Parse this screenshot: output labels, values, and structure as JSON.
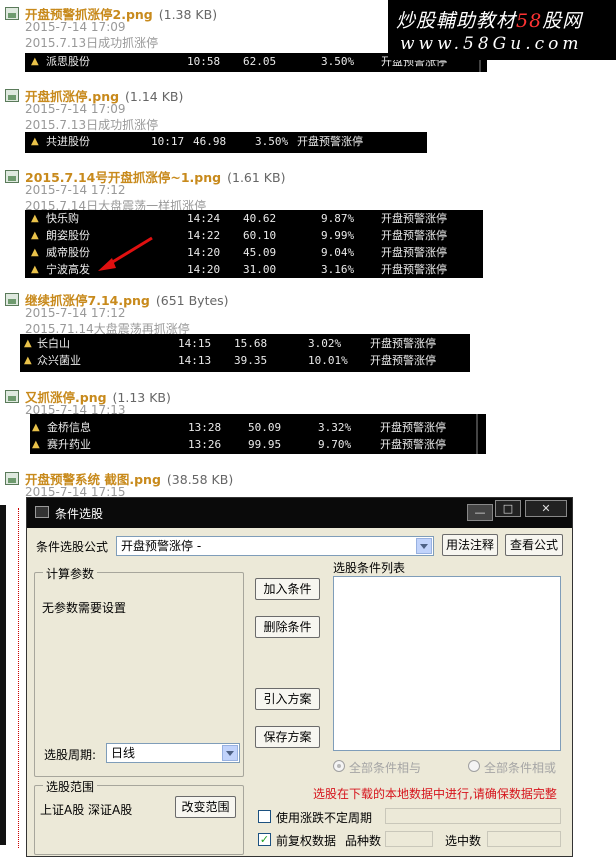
{
  "watermark": {
    "line1_main": "炒股輔助教材",
    "line1_num": "58",
    "line1_end": "股网",
    "line2": "www.58Gu.com"
  },
  "entries": [
    {
      "filename": "开盘预警抓涨停2.png",
      "size": "(1.38 KB)",
      "date": "2015-7-14 17:09",
      "note": "2015.7.13日成功抓涨停",
      "rows": [
        {
          "name": "派思股份",
          "time": "10:58",
          "price": "62.05",
          "pct": "3.50%",
          "cond": "开盘预警涨停"
        }
      ]
    },
    {
      "filename": "开盘抓涨停.png",
      "size": "(1.14 KB)",
      "date": "2015-7-14 17:09",
      "note": "2015.7.13日成功抓涨停",
      "rows": [
        {
          "name": "共进股份",
          "time": "10:17",
          "price": "46.98",
          "pct": "3.50%",
          "cond": "开盘预警涨停"
        }
      ]
    },
    {
      "filename": "2015.7.14号开盘抓涨停~1.png",
      "size": "(1.61 KB)",
      "date": "2015-7-14 17:12",
      "note": "2015.7.14日大盘震荡一样抓涨停",
      "rows": [
        {
          "name": "快乐购",
          "time": "14:24",
          "price": "40.62",
          "pct": "9.87%",
          "cond": "开盘预警涨停"
        },
        {
          "name": "朗姿股份",
          "time": "14:22",
          "price": "60.10",
          "pct": "9.99%",
          "cond": "开盘预警涨停"
        },
        {
          "name": "威帝股份",
          "time": "14:20",
          "price": "45.09",
          "pct": "9.04%",
          "cond": "开盘预警涨停"
        },
        {
          "name": "宁波高发",
          "time": "14:20",
          "price": "31.00",
          "pct": "3.16%",
          "cond": "开盘预警涨停"
        }
      ]
    },
    {
      "filename": "继续抓涨停7.14.png",
      "size": "(651 Bytes)",
      "date": "2015-7-14 17:12",
      "note": "2015.71.14大盘震荡再抓涨停",
      "rows": [
        {
          "name": "长白山",
          "time": "14:15",
          "price": "15.68",
          "pct": "3.02%",
          "cond": "开盘预警涨停"
        },
        {
          "name": "众兴菌业",
          "time": "14:13",
          "price": "39.35",
          "pct": "10.01%",
          "cond": "开盘预警涨停"
        }
      ]
    },
    {
      "filename": "又抓涨停.png",
      "size": "(1.13 KB)",
      "date": "2015-7-14 17:13",
      "rows": [
        {
          "name": "金桥信息",
          "time": "13:28",
          "price": "50.09",
          "pct": "3.32%",
          "cond": "开盘预警涨停"
        },
        {
          "name": "赛升药业",
          "time": "13:26",
          "price": "99.95",
          "pct": "9.70%",
          "cond": "开盘预警涨停"
        }
      ]
    },
    {
      "filename": "开盘预警系统 截图.png",
      "size": "(38.58 KB)",
      "date": "2015-7-14 17:15"
    }
  ],
  "dialog": {
    "title": "条件选股",
    "btn_min": "—",
    "btn_max": "□",
    "btn_close": "✕",
    "formula_label": "条件选股公式",
    "formula_value": "开盘预警涨停 -",
    "usage_button": "用法注释",
    "view_formula_button": "查看公式",
    "calc_group_title": "计算参数",
    "no_params_text": "无参数需要设置",
    "period_label": "选股周期:",
    "period_value": "日线",
    "add_condition_button": "加入条件",
    "delete_condition_button": "删除条件",
    "import_plan_button": "引入方案",
    "save_plan_button": "保存方案",
    "condition_list_label": "选股条件列表",
    "radio_and": "全部条件相与",
    "radio_or": "全部条件相或",
    "range_group_title": "选股范围",
    "range_value": "上证A股 深证A股",
    "change_range_button": "改变范围",
    "warning_text": "选股在下载的本地数据中进行,请确保数据完整",
    "variable_period_label": "使用涨跌不定周期",
    "adjusted_label": "前复权数据",
    "variety_count_label": "品种数",
    "selected_count_label": "选中数"
  }
}
